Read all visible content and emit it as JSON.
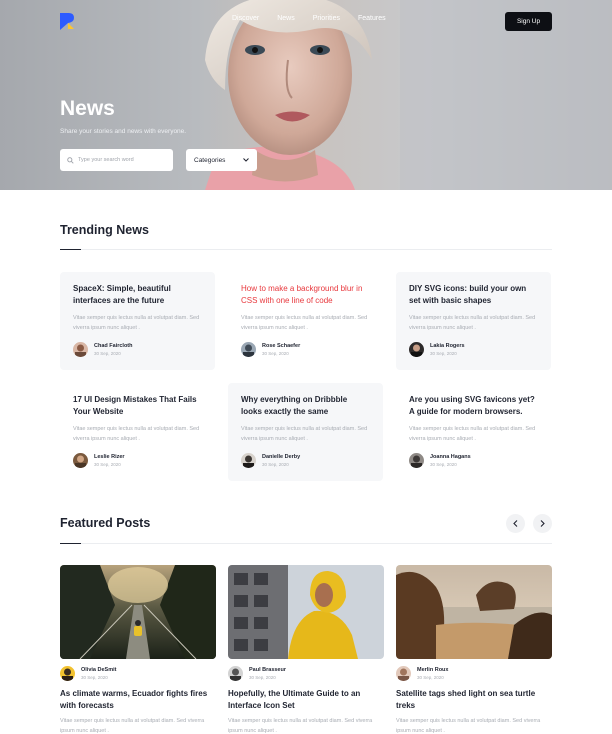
{
  "nav": {
    "items": [
      "Discover",
      "News",
      "Priorities",
      "Features"
    ],
    "signup_label": "Sign Up"
  },
  "hero": {
    "title": "News",
    "subtitle": "Share your stories and news with everyone.",
    "search_placeholder": "Type your search word",
    "category_label": "Categories"
  },
  "trending": {
    "title": "Trending News",
    "cards": [
      {
        "title": "SpaceX: Simple, beautiful interfaces are the future",
        "excerpt": "Vitae semper quis lectus nulla at volutpat diam. Sed viverra ipsum nunc aliquet .",
        "author": "Chad Faircloth",
        "date": "30 Sep, 2020",
        "highlight": false
      },
      {
        "title": "How to make a background blur in CSS with one line of code",
        "excerpt": "Vitae semper quis lectus nulla at volutpat diam. Sed viverra ipsum nunc aliquet .",
        "author": "Rose Schaefer",
        "date": "30 Sep, 2020",
        "highlight": true
      },
      {
        "title": "DIY SVG icons: build your own set with basic shapes",
        "excerpt": "Vitae semper quis lectus nulla at volutpat diam. Sed viverra ipsum nunc aliquet .",
        "author": "Lakia Rogers",
        "date": "30 Sep, 2020",
        "highlight": false
      },
      {
        "title": "17 UI Design Mistakes That Fails Your Website",
        "excerpt": "Vitae semper quis lectus nulla at volutpat diam. Sed viverra ipsum nunc aliquet .",
        "author": "Leslie Rizer",
        "date": "30 Sep, 2020",
        "highlight": false
      },
      {
        "title": "Why everything on Dribbble looks exactly the same",
        "excerpt": "Vitae semper quis lectus nulla at volutpat diam. Sed viverra ipsum nunc aliquet .",
        "author": "Danielle Derby",
        "date": "30 Sep, 2020",
        "highlight": false
      },
      {
        "title": "Are you using SVG favicons yet? A guide for modern browsers.",
        "excerpt": "Vitae semper quis lectus nulla at volutpat diam. Sed viverra ipsum nunc aliquet .",
        "author": "Joanna Hagans",
        "date": "30 Sep, 2020",
        "highlight": false
      }
    ]
  },
  "featured": {
    "title": "Featured Posts",
    "prev_icon": "chevron-left-icon",
    "next_icon": "chevron-right-icon",
    "posts": [
      {
        "author": "Olivia DeSmit",
        "date": "30 Sep, 2020",
        "title": "As climate warms, Ecuador fights fires with forecasts",
        "excerpt": "Vitae semper quis lectus nulla at volutpat diam. Sed viverra ipsum nunc aliquet ."
      },
      {
        "author": "Paul Brasseur",
        "date": "30 Sep, 2020",
        "title": "Hopefully, the Ultimate Guide to an Interface Icon Set",
        "excerpt": "Vitae semper quis lectus nulla at volutpat diam. Sed viverra ipsum nunc aliquet ."
      },
      {
        "author": "Merlin Roux",
        "date": "30 Sep, 2020",
        "title": "Satellite tags shed light on sea turtle treks",
        "excerpt": "Vitae semper quis lectus nulla at volutpat diam. Sed viverra ipsum nunc aliquet ."
      }
    ]
  },
  "colors": {
    "accent_red": "#e8383d",
    "logo_blue": "#2d5bff",
    "logo_yellow": "#ffc72c",
    "dark": "#1f2330"
  }
}
